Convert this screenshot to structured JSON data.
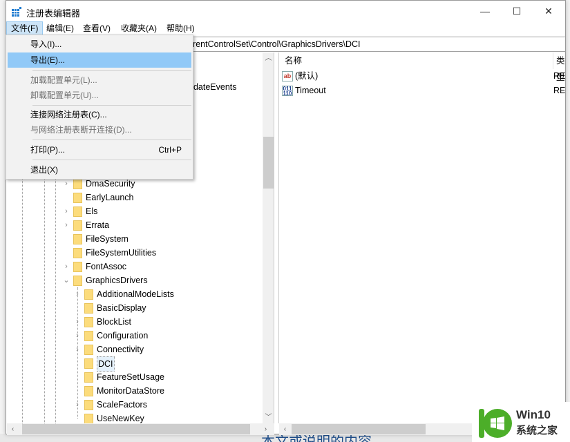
{
  "window": {
    "title": "注册表编辑器",
    "minimize": "—",
    "maximize": "☐",
    "close": "✕"
  },
  "menubar": [
    "文件(F)",
    "编辑(E)",
    "查看(V)",
    "收藏夹(A)",
    "帮助(H)"
  ],
  "address": "计算机\\HKEY_LOCAL_MACHINE\\SYSTEM\\CurrentControlSet\\Control\\GraphicsDrivers\\DCI",
  "file_menu": {
    "import": "导入(I)...",
    "export": "导出(E)...",
    "load_hive": "加载配置单元(L)...",
    "unload_hive": "卸载配置单元(U)...",
    "connect": "连接网络注册表(C)...",
    "disconnect": "与网络注册表断开连接(D)...",
    "print": "打印(P)...",
    "print_shortcut": "Ctrl+P",
    "exit": "退出(X)"
  },
  "tree": {
    "partial": "pdateEvents",
    "level1": [
      {
        "label": "DmaSecurity",
        "expandable": true
      },
      {
        "label": "EarlyLaunch",
        "expandable": false
      },
      {
        "label": "Els",
        "expandable": true
      },
      {
        "label": "Errata",
        "expandable": true
      },
      {
        "label": "FileSystem",
        "expandable": false
      },
      {
        "label": "FileSystemUtilities",
        "expandable": false
      },
      {
        "label": "FontAssoc",
        "expandable": true
      },
      {
        "label": "GraphicsDrivers",
        "expandable": true,
        "expanded": true
      }
    ],
    "level2": [
      {
        "label": "AdditionalModeLists",
        "expandable": true
      },
      {
        "label": "BasicDisplay",
        "expandable": false
      },
      {
        "label": "BlockList",
        "expandable": true
      },
      {
        "label": "Configuration",
        "expandable": true
      },
      {
        "label": "Connectivity",
        "expandable": true
      },
      {
        "label": "DCI",
        "expandable": false,
        "selected": true
      },
      {
        "label": "FeatureSetUsage",
        "expandable": false
      },
      {
        "label": "MonitorDataStore",
        "expandable": false
      },
      {
        "label": "ScaleFactors",
        "expandable": true
      },
      {
        "label": "UseNewKey",
        "expandable": false
      }
    ]
  },
  "values": {
    "col_name": "名称",
    "col_type": "类型",
    "rows": [
      {
        "name": "(默认)",
        "type": "RE",
        "icon": "string-value-icon"
      },
      {
        "name": "Timeout",
        "type": "RE",
        "icon": "binary-value-icon"
      }
    ]
  },
  "background_text": "本文或说明的内容",
  "logo": {
    "line1": "Win10",
    "line2": "系统之家"
  }
}
